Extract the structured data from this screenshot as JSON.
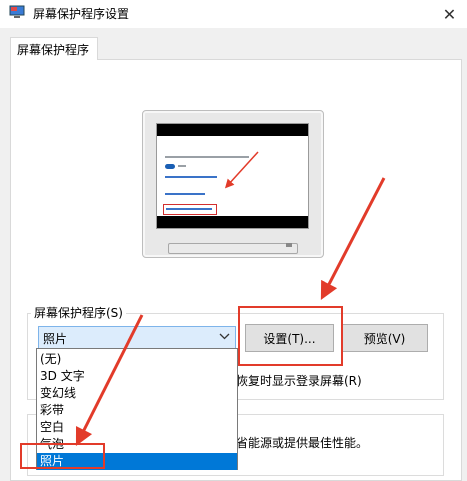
{
  "window": {
    "title": "屏幕保护程序设置",
    "close_glyph": "✕"
  },
  "tabs": [
    {
      "label": "屏幕保护程序"
    }
  ],
  "screensaver": {
    "group_label": "屏幕保护程序(S)",
    "selected": "照片",
    "settings_button": "设置(T)...",
    "preview_button": "预览(V)",
    "resume_text": "恢复时显示登录屏幕(R)",
    "options": [
      "(无)",
      "3D 文字",
      "变幻线",
      "彩带",
      "空白",
      "气泡",
      "照片"
    ],
    "selected_index": 6
  },
  "power": {
    "text": "省能源或提供最佳性能。"
  },
  "colors": {
    "annotation_red": "#e23b2a",
    "selection_blue": "#0078d7"
  }
}
